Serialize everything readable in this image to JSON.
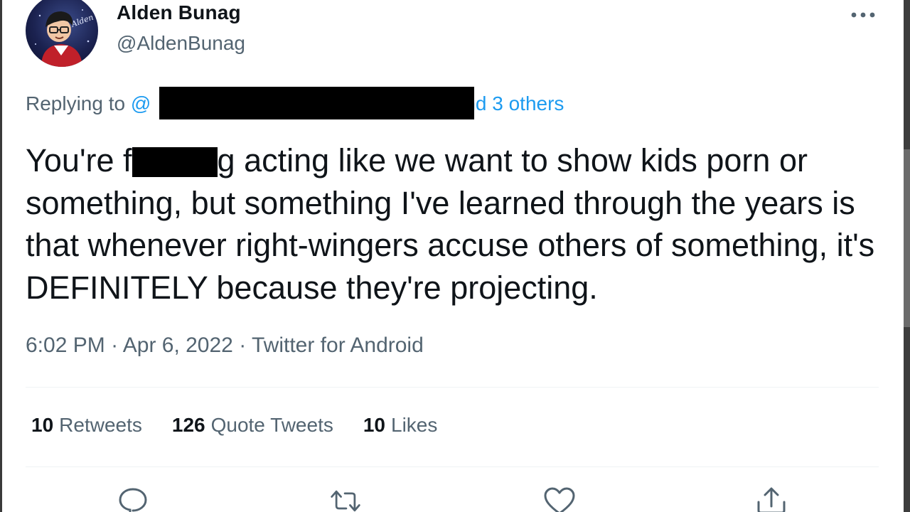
{
  "author": {
    "name": "Alden Bunag",
    "handle": "@AldenBunag",
    "avatar_label": "Alden"
  },
  "reply": {
    "prefix": "Replying to ",
    "mention_start": "@",
    "mention_end": "nd 3 others"
  },
  "tweet": {
    "text_part1": "You're f",
    "text_part2": "g acting like we want to show kids porn or something, but something I've learned through the years is that whenever right-wingers accuse others of something, it's DEFINITELY because they're projecting."
  },
  "meta": {
    "time": "6:02 PM",
    "separator": " · ",
    "date": "Apr 6, 2022",
    "source": "Twitter for Android"
  },
  "stats": {
    "retweets_count": "10",
    "retweets_label": "Retweets",
    "quotes_count": "126",
    "quotes_label": "Quote Tweets",
    "likes_count": "10",
    "likes_label": "Likes"
  },
  "colors": {
    "text": "#0f1419",
    "secondary": "#536471",
    "link": "#1d9bf0",
    "divider": "#eff3f4"
  },
  "icons": [
    "more-horizontal-icon",
    "reply-icon",
    "retweet-icon",
    "like-icon",
    "share-icon"
  ]
}
